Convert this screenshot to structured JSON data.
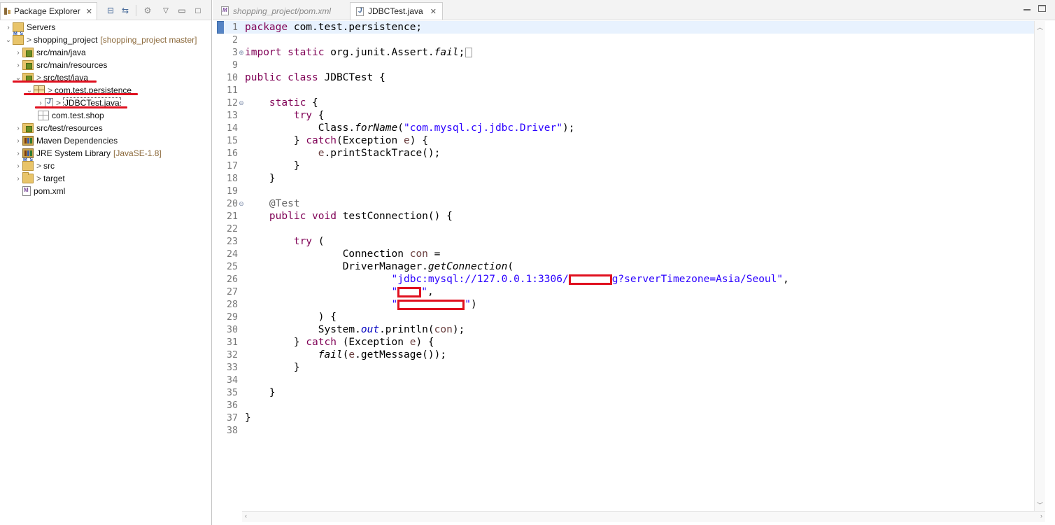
{
  "explorer": {
    "title": "Package Explorer",
    "tree": [
      {
        "label": "Servers",
        "decoration": ""
      },
      {
        "label": "shopping_project",
        "decoration": "[shopping_project master]"
      },
      {
        "label": "src/main/java",
        "decoration": ""
      },
      {
        "label": "src/main/resources",
        "decoration": ""
      },
      {
        "label": "src/test/java",
        "decoration": ""
      },
      {
        "label": "com.test.persistence",
        "decoration": ""
      },
      {
        "label": "JDBCTest.java",
        "decoration": ""
      },
      {
        "label": "com.test.shop",
        "decoration": ""
      },
      {
        "label": "src/test/resources",
        "decoration": ""
      },
      {
        "label": "Maven Dependencies",
        "decoration": ""
      },
      {
        "label": "JRE System Library",
        "decoration": "[JavaSE-1.8]"
      },
      {
        "label": "src",
        "decoration": ""
      },
      {
        "label": "target",
        "decoration": ""
      },
      {
        "label": "pom.xml",
        "decoration": ""
      }
    ],
    "change_marker": ">"
  },
  "editor": {
    "tabs": [
      {
        "label": "shopping_project/pom.xml",
        "active": false
      },
      {
        "label": "JDBCTest.java",
        "active": true
      }
    ],
    "line_numbers": [
      "1",
      "2",
      "3",
      "9",
      "10",
      "11",
      "12",
      "13",
      "14",
      "15",
      "16",
      "17",
      "18",
      "19",
      "20",
      "21",
      "22",
      "23",
      "24",
      "25",
      "26",
      "27",
      "28",
      "29",
      "30",
      "31",
      "32",
      "33",
      "34",
      "35",
      "36",
      "37",
      "38"
    ],
    "code": {
      "l1_kw": "package",
      "l1_rest": " com.test.persistence;",
      "l3_kw": "import static",
      "l3_rest": " org.junit.Assert.",
      "l3_it": "fail",
      "l3_end": ";",
      "l10_kw": "public class",
      "l10_rest": " JDBCTest {",
      "l12_kw": "static",
      "l12_rest": " {",
      "l13_kw": "try",
      "l13_rest": " {",
      "l14_a": "Class.",
      "l14_it": "forName",
      "l14_b": "(",
      "l14_str": "\"com.mysql.cj.jdbc.Driver\"",
      "l14_c": ");",
      "l15_a": "} ",
      "l15_kw": "catch",
      "l15_b": "(Exception ",
      "l15_var": "e",
      "l15_c": ") {",
      "l16_var": "e",
      "l16_rest": ".printStackTrace();",
      "l17": "}",
      "l18": "}",
      "l20_ann": "@Test",
      "l21_kw": "public void",
      "l21_rest": " testConnection() {",
      "l23_kw": "try",
      "l23_rest": " (",
      "l24_a": "Connection ",
      "l24_var": "con",
      "l24_b": " =",
      "l25_a": "DriverManager.",
      "l25_it": "getConnection",
      "l25_b": "(",
      "l26_str_a": "\"jdbc:mysql://127.0.0.1:3306/",
      "l26_str_b": "g?serverTimezone=Asia/Seoul\"",
      "l26_end": ",",
      "l27_q1": "\"",
      "l27_q2": "\"",
      "l27_end": ",",
      "l28_q1": "\"",
      "l28_q2": "\"",
      "l28_end": ")",
      "l29": ") {",
      "l30_a": "System.",
      "l30_it": "out",
      "l30_b": ".println(",
      "l30_var": "con",
      "l30_c": ");",
      "l31_a": "} ",
      "l31_kw": "catch",
      "l31_b": " (Exception ",
      "l31_var": "e",
      "l31_c": ") {",
      "l32_it": "fail",
      "l32_a": "(",
      "l32_var": "e",
      "l32_b": ".getMessage());",
      "l33": "}",
      "l35": "}",
      "l37": "}"
    }
  }
}
